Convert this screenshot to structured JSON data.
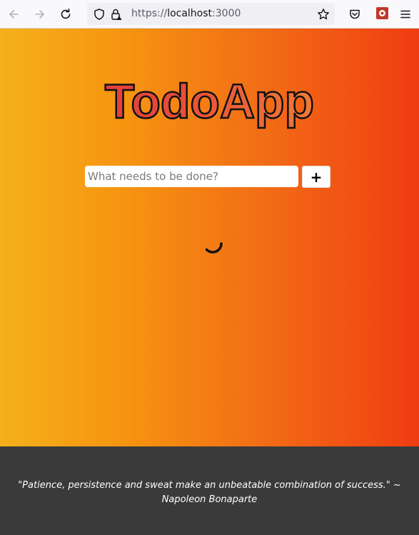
{
  "browser": {
    "url_scheme": "https://",
    "url_host": "localhost",
    "url_port": ":3000"
  },
  "app": {
    "title": "TodoApp",
    "input_placeholder": "What needs to be done?",
    "input_value": "",
    "add_button_label": "+",
    "loading": true
  },
  "footer": {
    "quote": "\"Patience, persistence and sweat make an unbeatable combination of success.\" ~ Napoleon Bonaparte"
  },
  "colors": {
    "gradient_left": "#f5b01b",
    "gradient_right": "#f03c11",
    "footer_background": "#3a3a3a",
    "title_fill_start": "#d92e3e",
    "title_fill_end": "#f59a2e"
  }
}
